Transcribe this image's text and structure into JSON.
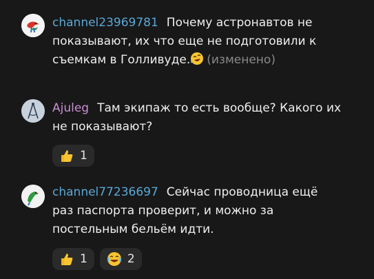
{
  "messages": [
    {
      "author": "channel23969781",
      "author_color": "#5aa9d8",
      "text": "Почему астронавтов не показывают, их что еще не подготовили к съемкам в Голливуде.",
      "inline_emoji": "rolling-on-floor-laughing",
      "edited_label": "(изменено)",
      "reactions": []
    },
    {
      "author": "Ajuleg",
      "author_color": "#c98fd6",
      "text": "Там экипаж то есть вообще? Какого их не показывают?",
      "reactions": [
        {
          "emoji": "thumbs-up",
          "count": "1"
        }
      ]
    },
    {
      "author": "channel77236697",
      "author_color": "#5aa9d8",
      "text": "Сейчас проводница ещё раз паспорта проверит, и можно за постельным бельём идти.",
      "reactions": [
        {
          "emoji": "thumbs-up",
          "count": "1"
        },
        {
          "emoji": "face-with-tears-of-joy",
          "count": "2"
        }
      ]
    }
  ]
}
